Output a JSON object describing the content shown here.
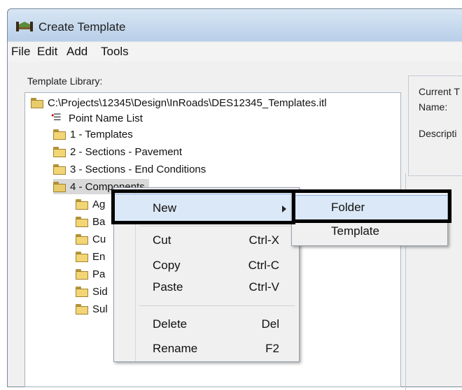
{
  "window": {
    "title": "Create Template"
  },
  "menubar": {
    "items": [
      "File",
      "Edit",
      "Add",
      "Tools"
    ]
  },
  "library": {
    "label": "Template Library:",
    "root": "C:\\Projects\\12345\\Design\\InRoads\\DES12345_Templates.itl",
    "point_name_list": "Point Name List",
    "folders": [
      "1 - Templates",
      "2 - Sections - Pavement",
      "3 - Sections - End Conditions"
    ],
    "selected_folder": "4 - Components",
    "subfolders": [
      "Ag",
      "Ba",
      "Cu",
      "En",
      "Pa",
      "Sid",
      "Sul"
    ]
  },
  "right_pane": {
    "group_label": "Current T",
    "name_label": "Name:",
    "description_label": "Descripti"
  },
  "context_menu": {
    "items": [
      {
        "label": "New",
        "shortcut": "",
        "submenu": true
      },
      {
        "label": "Cut",
        "shortcut": "Ctrl-X"
      },
      {
        "label": "Copy",
        "shortcut": "Ctrl-C"
      },
      {
        "label": "Paste",
        "shortcut": "Ctrl-V"
      },
      {
        "label": "Delete",
        "shortcut": "Del"
      },
      {
        "label": "Rename",
        "shortcut": "F2"
      }
    ],
    "highlighted": "New"
  },
  "submenu": {
    "items": [
      {
        "label": "Folder"
      },
      {
        "label": "Template"
      }
    ],
    "highlighted": "Folder"
  },
  "colors": {
    "title_gradient": "#b8cfe8",
    "menu_highlight": "#dbe8f7",
    "annotation_box": "#000000"
  }
}
